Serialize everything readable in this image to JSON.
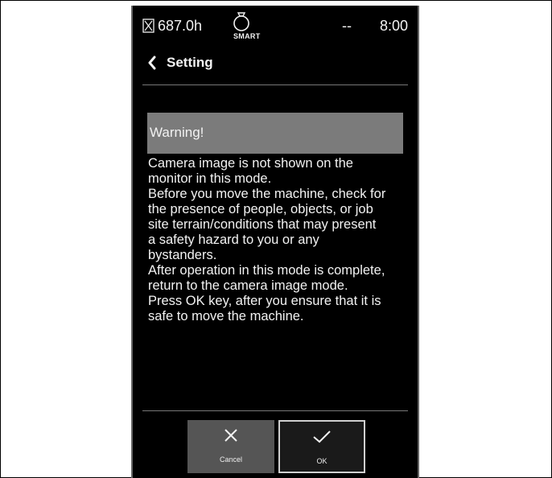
{
  "status": {
    "hours": "687.0h",
    "smart_label": "SMART",
    "dash": "--",
    "clock": "8:00",
    "icons": [
      "hourglass-icon",
      "smart-mode-icon"
    ]
  },
  "header": {
    "back_icon": "chevron-left-icon",
    "title": "Setting"
  },
  "warning": {
    "title": "Warning!",
    "lines": [
      "Camera image is not shown on the",
      "monitor in this mode.",
      "Before you move the machine, check for",
      "the presence of people, objects, or job",
      "site terrain/conditions that may present",
      "a safety hazard to you or any",
      "bystanders.",
      "After operation in this mode is complete,",
      "return to the camera image mode.",
      "Press OK key, after you ensure that it is",
      "safe to move the machine."
    ]
  },
  "buttons": {
    "cancel": {
      "label": "Cancel",
      "icon": "x-icon"
    },
    "ok": {
      "label": "OK",
      "icon": "check-icon"
    }
  },
  "colors": {
    "screen_bg": "#000000",
    "warning_bar": "#7b7b7b",
    "cancel_bg": "#555555",
    "ok_border": "#cfcfcf"
  }
}
